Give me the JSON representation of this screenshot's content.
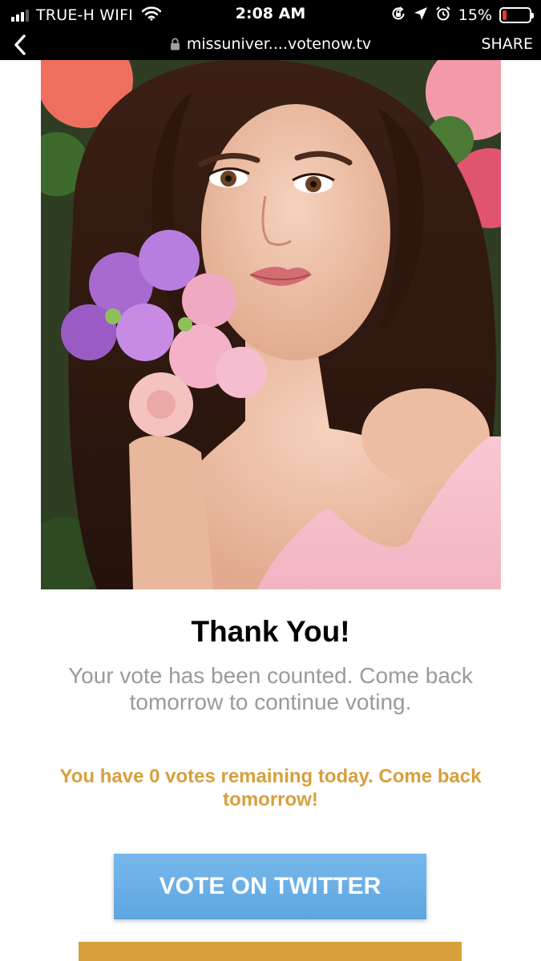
{
  "status_bar": {
    "carrier": "TRUE-H WIFI",
    "time": "2:08 AM",
    "battery_percent": "15%",
    "battery_level": 0.15,
    "battery_color": "#e53935"
  },
  "browser": {
    "url": "missuniver....votenow.tv",
    "share_label": "SHARE",
    "back_icon": "chevron-left-icon",
    "lock_icon": "lock-icon"
  },
  "content": {
    "title": "Thank You!",
    "message": "Your vote has been counted. Come back tomorrow to continue voting.",
    "votes_remaining_message": "You have 0 votes remaining today. Come back tomorrow!",
    "twitter_button_label": "VOTE ON TWITTER"
  },
  "colors": {
    "accent_gold": "#d7a03d",
    "twitter_blue": "#6aaee6",
    "muted_text": "#9a9a9a"
  }
}
